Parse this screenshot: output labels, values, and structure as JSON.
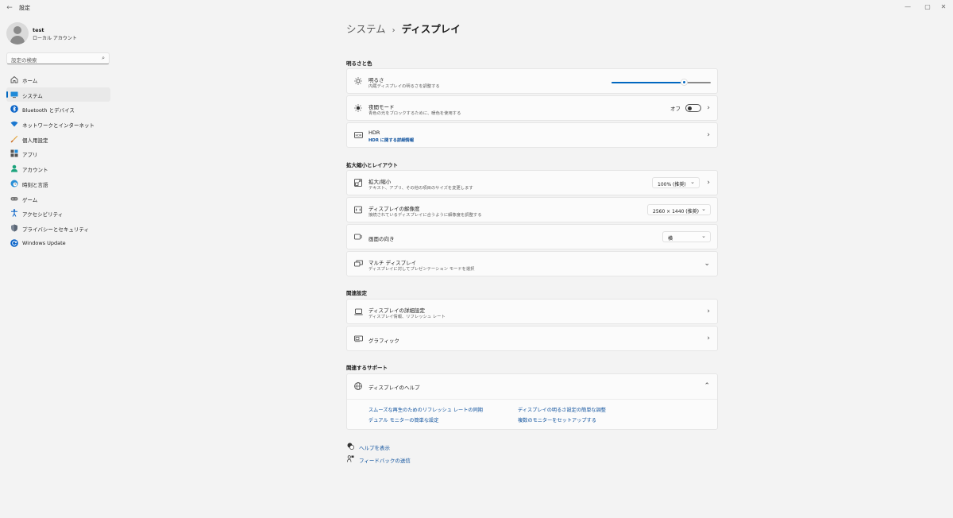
{
  "window": {
    "title": "設定",
    "back_icon": "←",
    "controls": {
      "minimize": "—",
      "maximize": "▢",
      "close": "✕"
    }
  },
  "profile": {
    "name": "test",
    "account_type": "ローカル アカウント"
  },
  "search": {
    "placeholder": "設定の検索"
  },
  "sidebar": {
    "items": [
      {
        "label": "ホーム",
        "icon": "home-icon",
        "active": false
      },
      {
        "label": "システム",
        "icon": "system-icon",
        "active": true
      },
      {
        "label": "Bluetooth とデバイス",
        "icon": "bluetooth-icon",
        "active": false
      },
      {
        "label": "ネットワークとインターネット",
        "icon": "network-icon",
        "active": false
      },
      {
        "label": "個人用設定",
        "icon": "brush-icon",
        "active": false
      },
      {
        "label": "アプリ",
        "icon": "apps-icon",
        "active": false
      },
      {
        "label": "アカウント",
        "icon": "account-icon",
        "active": false
      },
      {
        "label": "時刻と言語",
        "icon": "globe-clock-icon",
        "active": false
      },
      {
        "label": "ゲーム",
        "icon": "game-icon",
        "active": false
      },
      {
        "label": "アクセシビリティ",
        "icon": "accessibility-icon",
        "active": false
      },
      {
        "label": "プライバシーとセキュリティ",
        "icon": "shield-icon",
        "active": false
      },
      {
        "label": "Windows Update",
        "icon": "update-icon",
        "active": false
      }
    ]
  },
  "breadcrumb": {
    "parent": "システム",
    "separator": "›",
    "current": "ディスプレイ"
  },
  "sections": {
    "brightness_color": "明るさと色",
    "scale_layout": "拡大縮小とレイアウト",
    "related_settings": "関連設定",
    "related_support": "関連するサポート"
  },
  "brightness": {
    "title": "明るさ",
    "subtitle": "内蔵ディスプレイの明るさを調整する",
    "level": 0.73
  },
  "night_light": {
    "title": "夜間モード",
    "subtitle": "青色の光をブロックするために、暖色を使用する",
    "state_label": "オフ",
    "on": false
  },
  "hdr": {
    "title": "HDR",
    "link": "HDR に関する詳細情報"
  },
  "scale": {
    "title": "拡大/縮小",
    "subtitle": "テキスト、アプリ、その他の項目のサイズを変更します",
    "value": "100% (推奨)"
  },
  "resolution": {
    "title": "ディスプレイの解像度",
    "subtitle": "接続されているディスプレイに合うように解像度を調整する",
    "value": "2560 × 1440 (推奨)"
  },
  "orientation": {
    "title": "画面の向き",
    "value": "横"
  },
  "multi_display": {
    "title": "マルチ ディスプレイ",
    "subtitle": "ディスプレイに対してプレゼンテーション モードを選択"
  },
  "advanced_display": {
    "title": "ディスプレイの詳細設定",
    "subtitle": "ディスプレイ情報、リフレッシュ レート"
  },
  "graphics": {
    "title": "グラフィック"
  },
  "display_help": {
    "title": "ディスプレイのヘルプ",
    "links": [
      "スムーズな再生のためのリフレッシュ レートの同期",
      "ディスプレイの明るさ設定の簡単な調整",
      "デュアル モニターの簡単な設定",
      "複数のモニターをセットアップする"
    ]
  },
  "footer": {
    "get_help": "ヘルプを表示",
    "feedback": "フィードバックの送信"
  },
  "colors": {
    "accent": "#0067c0",
    "link": "#0b4f9c",
    "background": "#f3f3f3",
    "card": "#fbfbfb"
  }
}
